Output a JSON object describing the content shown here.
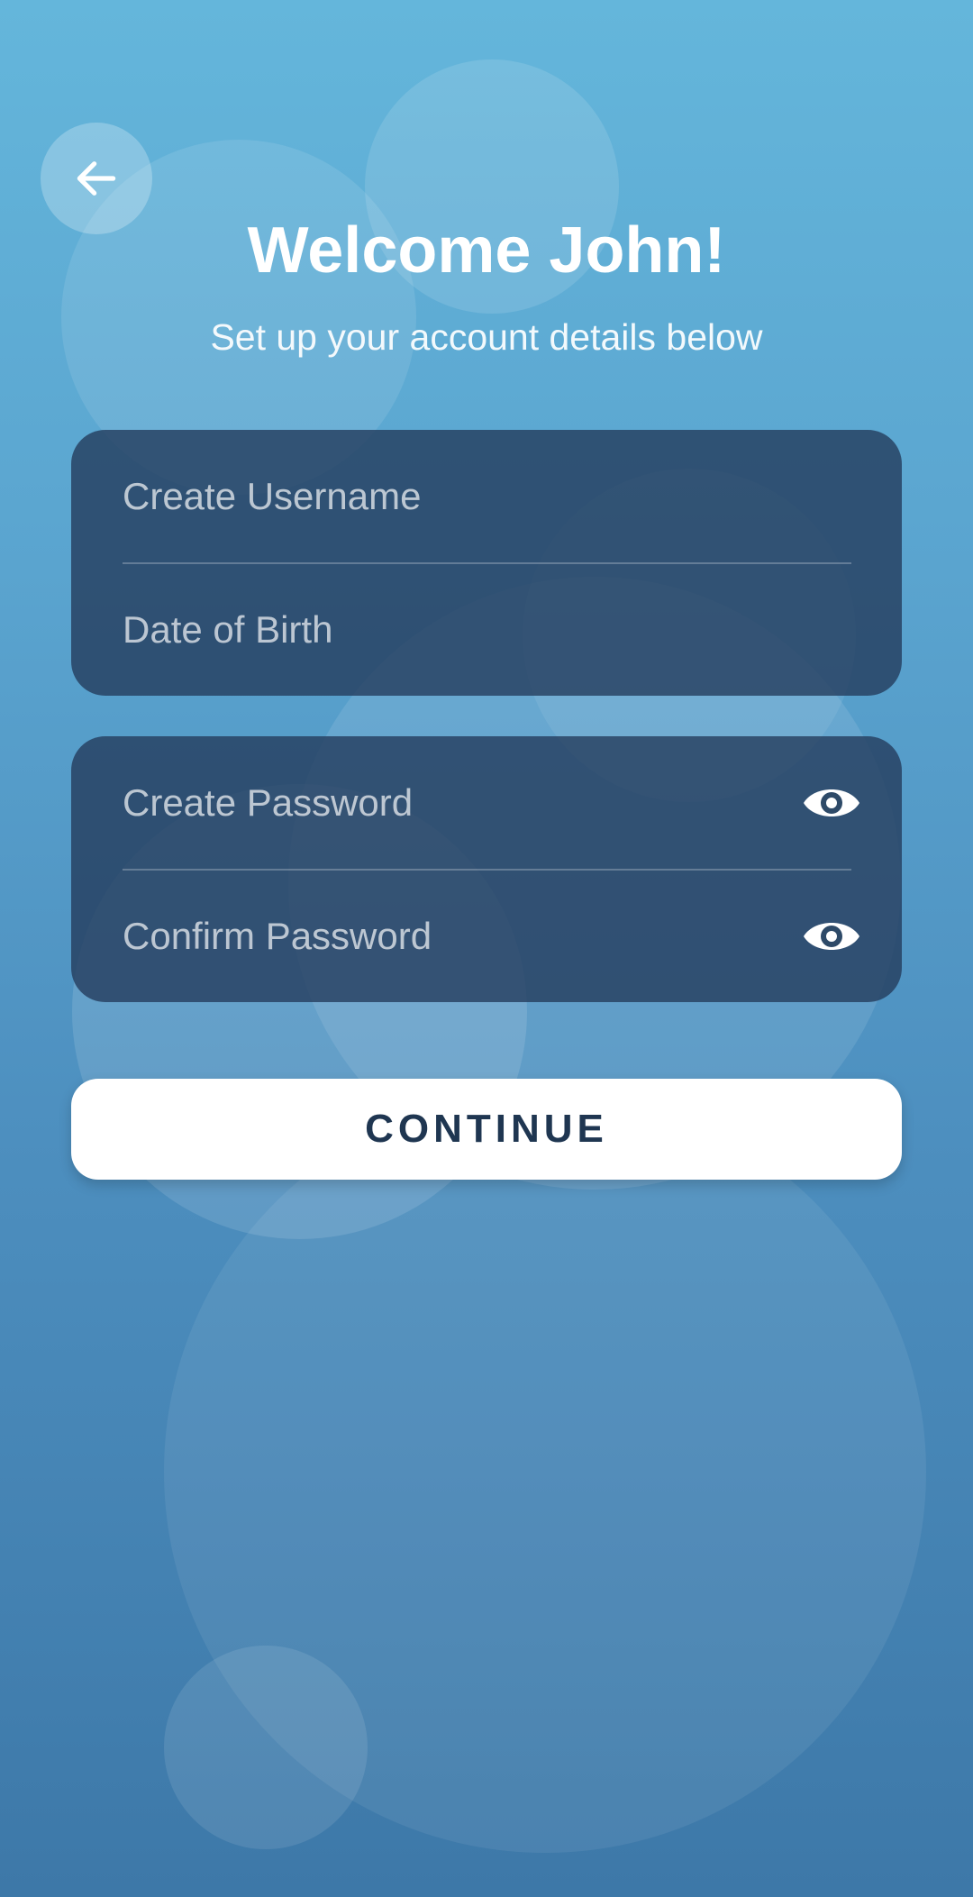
{
  "header": {
    "back_icon": "arrow-left-icon",
    "title": "Welcome John!",
    "subtitle": "Set up your account details below"
  },
  "account_card": {
    "username_placeholder": "Create Username",
    "dob_placeholder": "Date of Birth"
  },
  "password_card": {
    "password_placeholder": "Create Password",
    "confirm_placeholder": "Confirm Password",
    "visibility_icon": "eye-icon"
  },
  "actions": {
    "continue_label": "CONTINUE"
  },
  "colors": {
    "background_top": "#64b6db",
    "background_bottom": "#3d78a8",
    "card": "#243c5c",
    "button": "#ffffff",
    "button_text": "#1f3651"
  }
}
